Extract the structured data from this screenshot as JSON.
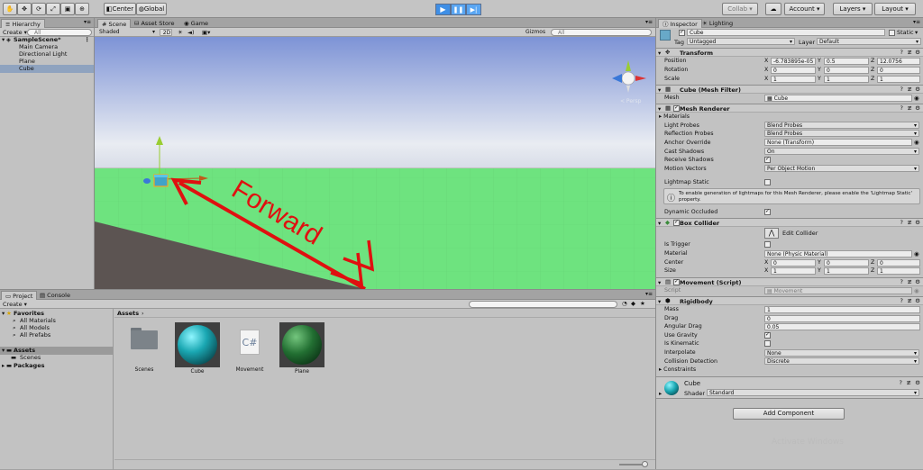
{
  "toolbar": {
    "pivot": "Center",
    "space": "Global",
    "collab": "Collab ▾",
    "account": "Account",
    "layers": "Layers",
    "layout": "Layout"
  },
  "hierarchy": {
    "tab": "Hierarchy",
    "create": "Create ▾",
    "search_placeholder": "All",
    "scene": "SampleScene*",
    "items": [
      "Main Camera",
      "Directional Light",
      "Plane",
      "Cube"
    ]
  },
  "scene_view": {
    "tabs": [
      "Scene",
      "Asset Store",
      "Game"
    ],
    "shading": "Shaded",
    "mode2d": "2D",
    "gizmos": "Gizmos ▾",
    "search_placeholder": "All",
    "gizmo_label": "< Persp",
    "annotation": "Forward",
    "colors": {
      "sky_top": "#7d93d6",
      "sky_horizon": "#e9ecf2",
      "ground": "#6ee37f",
      "underground": "#5c5452",
      "arrow": "#e01010"
    }
  },
  "project": {
    "tabs": [
      "Project",
      "Console"
    ],
    "create": "Create ▾",
    "favorites": "Favorites",
    "favorite_items": [
      "All Materials",
      "All Models",
      "All Prefabs"
    ],
    "assets": "Assets",
    "assets_children": [
      "Scenes"
    ],
    "packages": "Packages",
    "breadcrumb": "Assets",
    "asset_items": [
      {
        "label": "Scenes",
        "icon": "folder-icon"
      },
      {
        "label": "Cube",
        "icon": "sphere-icon"
      },
      {
        "label": "Movement",
        "icon": "csharp-script-icon",
        "glyph": "C#"
      },
      {
        "label": "Plane",
        "icon": "sphere-icon"
      }
    ]
  },
  "inspector": {
    "tabs": [
      "Inspector",
      "Lighting"
    ],
    "object_name": "Cube",
    "static_label": "Static",
    "tag_label": "Tag",
    "tag_value": "Untagged",
    "layer_label": "Layer",
    "layer_value": "Default",
    "transform": {
      "title": "Transform",
      "position_label": "Position",
      "rotation_label": "Rotation",
      "scale_label": "Scale",
      "position": [
        "-6.783895e-05",
        "0.5",
        "12.0756"
      ],
      "rotation": [
        "0",
        "0",
        "0"
      ],
      "scale": [
        "1",
        "1",
        "1"
      ]
    },
    "mesh_filter": {
      "title": "Cube (Mesh Filter)",
      "mesh_label": "Mesh",
      "mesh_value": "Cube"
    },
    "mesh_renderer": {
      "title": "Mesh Renderer",
      "rows": [
        {
          "label": "Materials",
          "value": ""
        },
        {
          "label": "Light Probes",
          "value": "Blend Probes"
        },
        {
          "label": "Reflection Probes",
          "value": "Blend Probes"
        },
        {
          "label": "Anchor Override",
          "value": "None (Transform)"
        },
        {
          "label": "Cast Shadows",
          "value": "On"
        },
        {
          "label": "Receive Shadows",
          "value": ""
        },
        {
          "label": "Motion Vectors",
          "value": "Per Object Motion"
        }
      ],
      "lightmap_static": "Lightmap Static",
      "info": "To enable generation of lightmaps for this Mesh Renderer, please enable the 'Lightmap Static' property.",
      "dynamic_occluded": "Dynamic Occluded"
    },
    "box_collider": {
      "title": "Box Collider",
      "edit": "Edit Collider",
      "is_trigger": "Is Trigger",
      "material_label": "Material",
      "material_value": "None (Physic Material)",
      "center_label": "Center",
      "center": [
        "0",
        "0",
        "0"
      ],
      "size_label": "Size",
      "size": [
        "1",
        "1",
        "1"
      ]
    },
    "movement": {
      "title": "Movement (Script)",
      "script_label": "Script",
      "script_value": "Movement"
    },
    "rigidbody": {
      "title": "Rigidbody",
      "mass_label": "Mass",
      "mass": "1",
      "drag_label": "Drag",
      "drag": "0",
      "angular_drag_label": "Angular Drag",
      "angular_drag": "0.05",
      "use_gravity": "Use Gravity",
      "is_kinematic": "Is Kinematic",
      "interpolate_label": "Interpolate",
      "interpolate": "None",
      "collision_label": "Collision Detection",
      "collision": "Discrete",
      "constraints": "Constraints"
    },
    "material": {
      "name": "Cube",
      "shader_label": "Shader",
      "shader": "Standard"
    },
    "add_component": "Add Component",
    "watermark": "Activate Windows"
  }
}
